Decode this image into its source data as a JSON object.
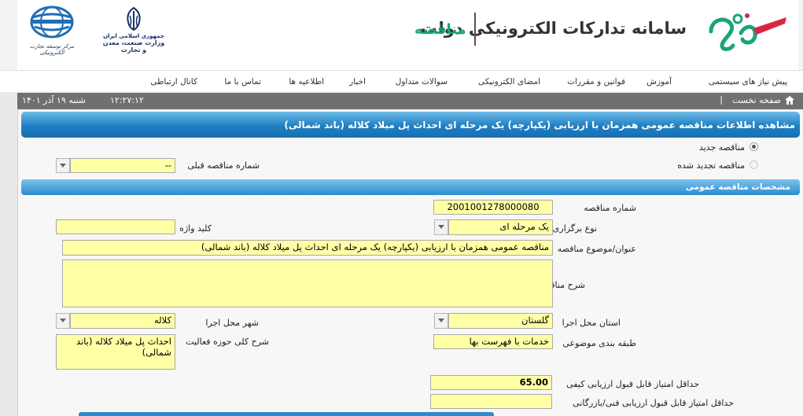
{
  "header": {
    "system_title": "سامانه تدارکات الکترونیکی دولت",
    "section_title": "مناقصه",
    "emblem_line1": "جمهوری اسلامی ایران",
    "emblem_line2": "وزارت صنعت، معدن و تجارت",
    "trade_center": "مرکز توسعه تجارت الکترونیکی"
  },
  "nav": {
    "items": [
      "پیش نیاز های سیستمی",
      "آموزش",
      "قوانین و مقررات",
      "امضای الکترونیکی",
      "سوالات متداول",
      "اخبار",
      "اطلاعیه ها",
      "تماس با ما",
      "کانال ارتباطی"
    ]
  },
  "infobar": {
    "home_label": "صفحه نخست",
    "separator": "|",
    "date": "شنبه ۱۹ آذر ۱۴۰۱",
    "time": "۱۲:۲۷:۱۲"
  },
  "page": {
    "title": "مشاهده اطلاعات مناقصه عمومی همزمان با ارزیابی (یکپارچه) یک مرحله ای احداث پل میلاد کلاله (باند شمالی)"
  },
  "tender_type": {
    "new_label": "مناقصه جدید",
    "renewed_label": "مناقصه تجدید شده",
    "previous_number_label": "شماره مناقصه قبلی",
    "previous_number_value": "--"
  },
  "section": {
    "title": "مشخصات مناقصه عمومی"
  },
  "form": {
    "tender_number_label": "شماره مناقصه",
    "tender_number_value": "2001001278000080",
    "holding_type_label": "نوع برگزاری",
    "holding_type_value": "یک مرحله ای",
    "keyword_label": "کلید واژه",
    "keyword_value": "",
    "subject_label": "عنوان/موضوع مناقصه",
    "subject_value": "مناقصه عمومی همزمان با ارزیابی (یکپارچه) یک مرحله ای احداث پل میلاد کلاله (باند شمالی)",
    "description_label": "شرح مناقصه",
    "description_value": "",
    "province_label": "استان محل اجرا",
    "province_value": "گلستان",
    "city_label": "شهر محل اجرا",
    "city_value": "کلاله",
    "category_label": "طبقه بندی موضوعی",
    "category_value": "خدمات با فهرست بها",
    "activity_label": "شرح کلی حوزه فعالیت",
    "activity_value": "احداث پل میلاد کلاله (باند شمالی)",
    "quality_score_label": "حداقل امتیاز قابل قبول ارزیابی کیفی",
    "quality_score_value": "65.00",
    "technical_score_label": "حداقل امتیاز قابل قبول ارزیابی فنی/بازرگانی",
    "technical_score_value": ""
  },
  "colors": {
    "field_bg": "#ffffa6",
    "title_bar": "#1f7fc4",
    "brand_green": "#1aa37a",
    "brand_red": "#d9263f"
  }
}
